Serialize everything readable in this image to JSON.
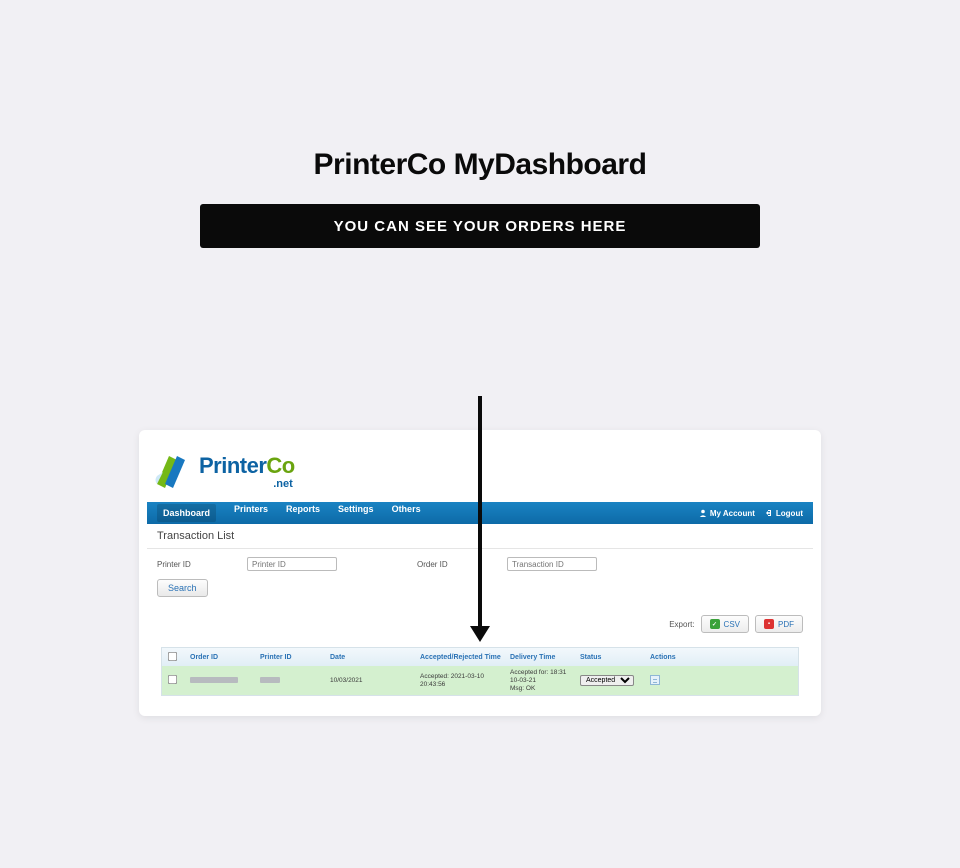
{
  "page": {
    "title": "PrinterCo MyDashboard",
    "callout": "YOU CAN SEE YOUR ORDERS HERE"
  },
  "logo": {
    "brand_p1": "Printer",
    "brand_p2": "Co",
    "suffix": ".net"
  },
  "nav": {
    "items": [
      "Dashboard",
      "Printers",
      "Reports",
      "Settings",
      "Others"
    ],
    "account": "My Account",
    "logout": "Logout"
  },
  "section": {
    "title": "Transaction List"
  },
  "filters": {
    "printer_label": "Printer ID",
    "printer_placeholder": "Printer ID",
    "order_label": "Order ID",
    "order_placeholder": "Transaction ID",
    "search": "Search"
  },
  "export": {
    "label": "Export:",
    "csv": "CSV",
    "pdf": "PDF"
  },
  "table": {
    "headers": {
      "order_id": "Order ID",
      "printer_id": "Printer ID",
      "date": "Date",
      "accepted": "Accepted/Rejected Time",
      "delivery": "Delivery Time",
      "status": "Status",
      "actions": "Actions"
    },
    "row": {
      "date": "10/03/2021",
      "accepted_line1": "Accepted: 2021-03-10",
      "accepted_line2": "20:43:56",
      "delivery_line1": "Accepted for: 18:31 10-03-21",
      "delivery_line2": "Msg: OK",
      "status_value": "Accepted"
    }
  }
}
